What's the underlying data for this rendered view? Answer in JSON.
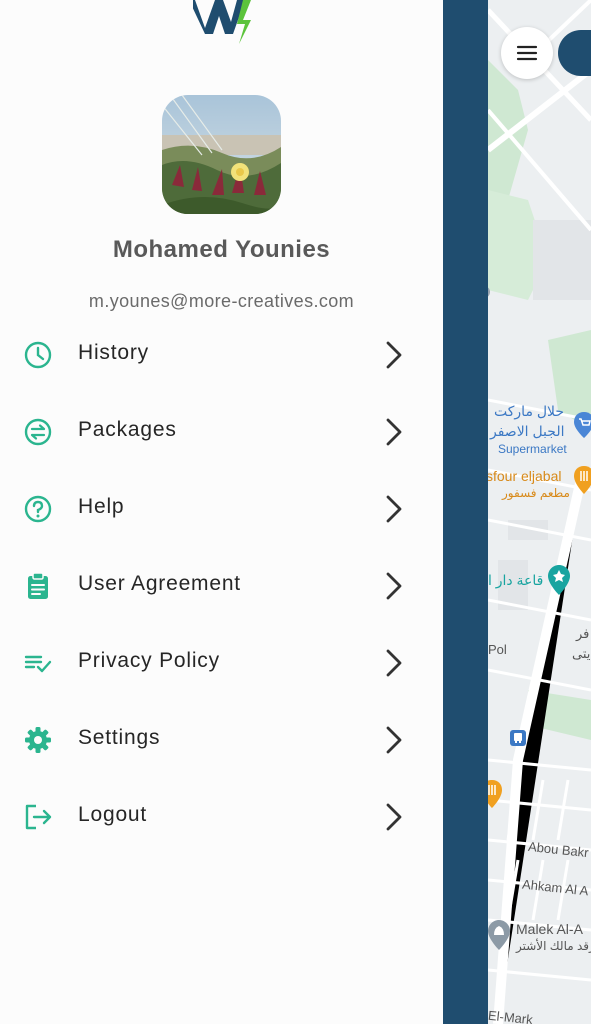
{
  "user": {
    "name": "Mohamed Younies",
    "email": "m.younes@more-creatives.com"
  },
  "menu": {
    "items": [
      {
        "label": "History",
        "icon": "clock-icon"
      },
      {
        "label": "Packages",
        "icon": "swap-icon"
      },
      {
        "label": "Help",
        "icon": "help-circle-icon"
      },
      {
        "label": "User Agreement",
        "icon": "clipboard-icon"
      },
      {
        "label": "Privacy Policy",
        "icon": "checklist-icon"
      },
      {
        "label": "Settings",
        "icon": "gear-icon"
      },
      {
        "label": "Logout",
        "icon": "logout-icon"
      }
    ]
  },
  "map": {
    "labels": {
      "halal_market_line1": "حلال ماركت",
      "halal_market_line2": "الجبل الاصفر",
      "supermarket": "Supermarket",
      "carrefour": "sfour eljabal",
      "carrefour_ar": "مطعم فسفور",
      "hall": "قاعة دار ا",
      "fr_line1": "فر",
      "fr_line2": "يتى",
      "pol": "Pol",
      "abou_bakr": "Abou Bakr",
      "ahkam": "Ahkam Al A",
      "malek_line1": "Malek Al-A",
      "malek_line2": "رقد مالك الأشتر",
      "el_mark": "El-Mark"
    }
  },
  "colors": {
    "accent": "#2bb58f",
    "brand_dark": "#1f4d6f",
    "text_primary": "#262626",
    "text_secondary": "#595959"
  }
}
